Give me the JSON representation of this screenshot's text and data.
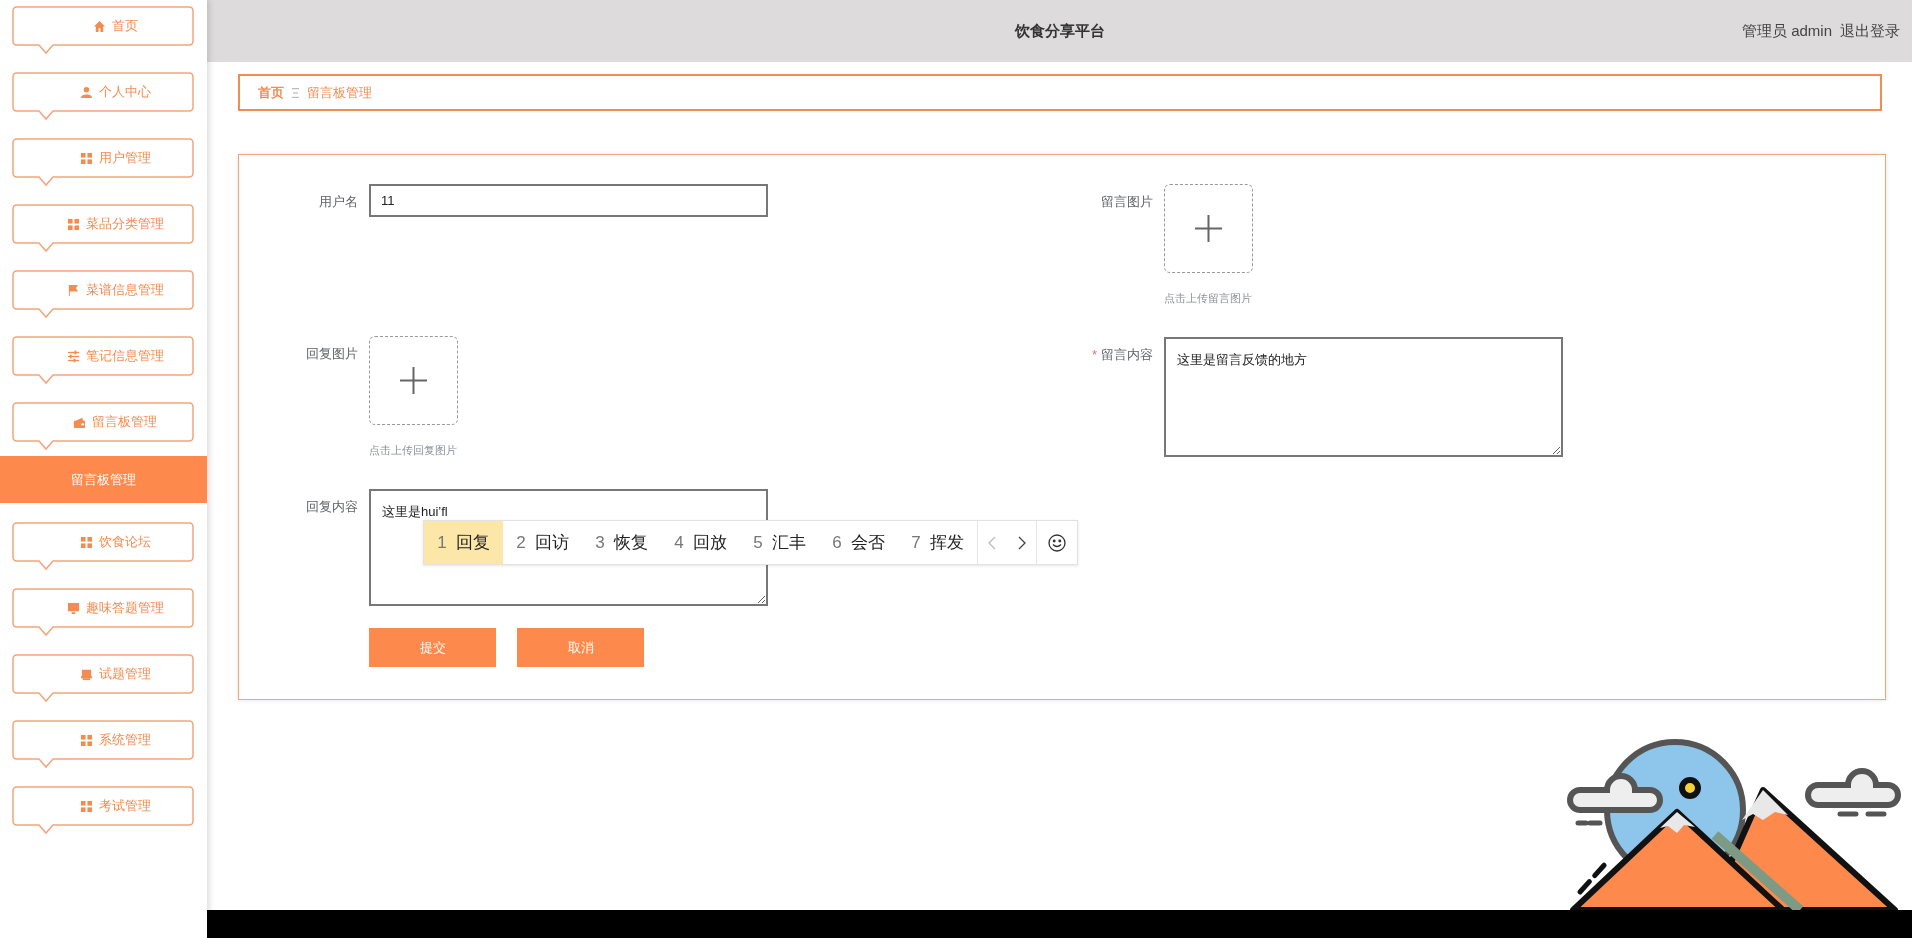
{
  "header": {
    "title": "饮食分享平台",
    "user": "管理员 admin",
    "logout": "退出登录"
  },
  "sidebar": {
    "items": [
      {
        "label": "首页",
        "selected": false
      },
      {
        "label": "个人中心",
        "selected": false
      },
      {
        "label": "用户管理",
        "selected": false
      },
      {
        "label": "菜品分类管理",
        "selected": false
      },
      {
        "label": "菜谱信息管理",
        "selected": false
      },
      {
        "label": "笔记信息管理",
        "selected": false
      },
      {
        "label": "留言板管理",
        "selected": false,
        "children": [
          {
            "label": "留言板管理",
            "selected": true
          }
        ]
      },
      {
        "label": "饮食论坛",
        "selected": false
      },
      {
        "label": "趣味答题管理",
        "selected": false
      },
      {
        "label": "试题管理",
        "selected": false
      },
      {
        "label": "系统管理",
        "selected": false
      },
      {
        "label": "考试管理",
        "selected": false
      }
    ]
  },
  "breadcrumb": [
    {
      "label": "首页",
      "current": false
    },
    {
      "label": "留言板管理",
      "current": true
    }
  ],
  "form": {
    "columns": [
      [
        {
          "kind": "input",
          "label": "用户名",
          "value": "11"
        },
        {
          "kind": "upload",
          "label": "回复图片",
          "hint": "点击上传回复图片"
        },
        {
          "kind": "textarea",
          "label": "回复内容",
          "value": "这里是hui’fl"
        }
      ],
      [
        {
          "kind": "upload",
          "label": "留言图片",
          "hint": "点击上传留言图片"
        },
        {
          "kind": "textarea",
          "label": "留言内容",
          "required_mark": "*",
          "value": "这里是留言反馈的地方"
        }
      ]
    ],
    "buttons": [
      "提交",
      "取消"
    ]
  },
  "ime": {
    "candidates": [
      {
        "number": "1",
        "text": "回复",
        "selected": true
      },
      {
        "number": "2",
        "text": "回访",
        "selected": false
      },
      {
        "number": "3",
        "text": "恢复",
        "selected": false
      },
      {
        "number": "4",
        "text": "回放",
        "selected": false
      },
      {
        "number": "5",
        "text": "汇丰",
        "selected": false
      },
      {
        "number": "6",
        "text": "会否",
        "selected": false
      },
      {
        "number": "7",
        "text": "挥发",
        "selected": false
      }
    ]
  }
}
